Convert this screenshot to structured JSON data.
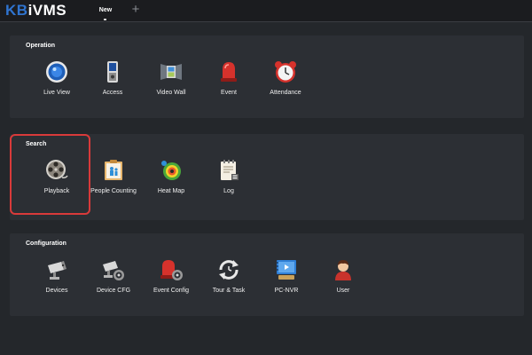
{
  "app": {
    "brand_prefix": "KB",
    "brand_suffix": "iVMS"
  },
  "tabs": [
    {
      "label": "New"
    }
  ],
  "sections": {
    "operation": {
      "title": "Operation",
      "items": [
        {
          "label": "Live View",
          "icon": "live-view-icon"
        },
        {
          "label": "Access",
          "icon": "access-control-icon"
        },
        {
          "label": "Video Wall",
          "icon": "video-wall-icon"
        },
        {
          "label": "Event",
          "icon": "alarm-light-icon"
        },
        {
          "label": "Attendance",
          "icon": "alarm-clock-icon"
        }
      ]
    },
    "search": {
      "title": "Search",
      "items": [
        {
          "label": "Playback",
          "icon": "film-reel-icon"
        },
        {
          "label": "People Counting",
          "icon": "people-counting-icon"
        },
        {
          "label": "Heat Map",
          "icon": "heat-map-icon"
        },
        {
          "label": "Log",
          "icon": "log-document-icon"
        }
      ]
    },
    "configuration": {
      "title": "Configuration",
      "items": [
        {
          "label": "Devices",
          "icon": "camera-device-icon"
        },
        {
          "label": "Device CFG",
          "icon": "camera-gear-icon"
        },
        {
          "label": "Event Config",
          "icon": "alarm-gear-icon"
        },
        {
          "label": "Tour & Task",
          "icon": "refresh-clock-icon"
        },
        {
          "label": "PC-NVR",
          "icon": "pc-nvr-icon"
        },
        {
          "label": "User",
          "icon": "user-icon"
        }
      ]
    }
  },
  "colors": {
    "background": "#24272b",
    "panel": "#2c2f34",
    "brand_blue": "#2f74d0",
    "highlight": "#d93a3a"
  }
}
